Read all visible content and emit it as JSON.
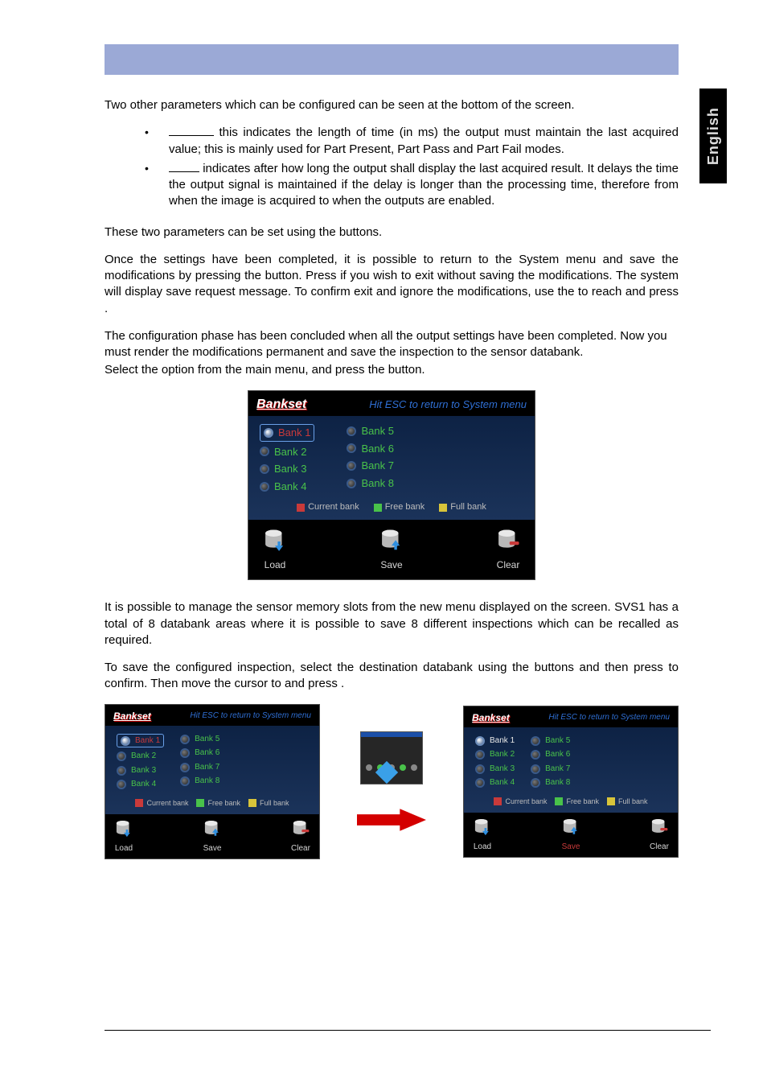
{
  "sideTab": "English",
  "para1": "Two other parameters which can be configured can be seen at the bottom of the screen.",
  "bullet1": "this indicates the length of time (in ms) the output must maintain the last acquired value; this is mainly used for Part Present, Part Pass and Part Fail modes.",
  "bullet2": "indicates after how long the output shall display the last acquired result. It delays the time the output signal is maintained if the delay is longer than the processing time, therefore from when the image is acquired to when the outputs are enabled.",
  "para2a": "These two parameters can be set using the ",
  "para2b": " buttons.",
  "para3a": "Once the settings have been completed, it is possible to return to the System menu and save the modifications by pressing the ",
  "para3b": " button. Press ",
  "para3c": " if you wish to exit without saving the modifications. The system will display save request message. To confirm exit and ignore the modifications, use the ",
  "para3d": " to reach ",
  "para3e": " and press ",
  "para3f": ".",
  "para4": "The configuration phase has been concluded when all the output settings have been completed. Now you must render the modifications permanent and save the inspection to the sensor databank.",
  "para5a": "Select the ",
  "para5b": " option from the main menu, and press the ",
  "para5c": " button.",
  "para6": "It is possible to manage the sensor memory slots from the new menu displayed on the screen. SVS1 has a total of 8 databank areas where it is possible to save 8 different inspections which can be recalled as required.",
  "para7a": "To save the configured inspection, select the destination databank using the ",
  "para7b": " buttons and then press ",
  "para7c": " to confirm. Then move the cursor to ",
  "para7d": " and press ",
  "para7e": ".",
  "bankset": {
    "title": "Bankset",
    "hint": "Hit ESC to return to System menu",
    "banks_left": [
      "Bank 1",
      "Bank 2",
      "Bank 3",
      "Bank 4"
    ],
    "banks_right": [
      "Bank 5",
      "Bank 6",
      "Bank 7",
      "Bank 8"
    ],
    "legend_current": "Current bank",
    "legend_free": "Free bank",
    "legend_full": "Full bank",
    "load": "Load",
    "save": "Save",
    "clear": "Clear"
  }
}
